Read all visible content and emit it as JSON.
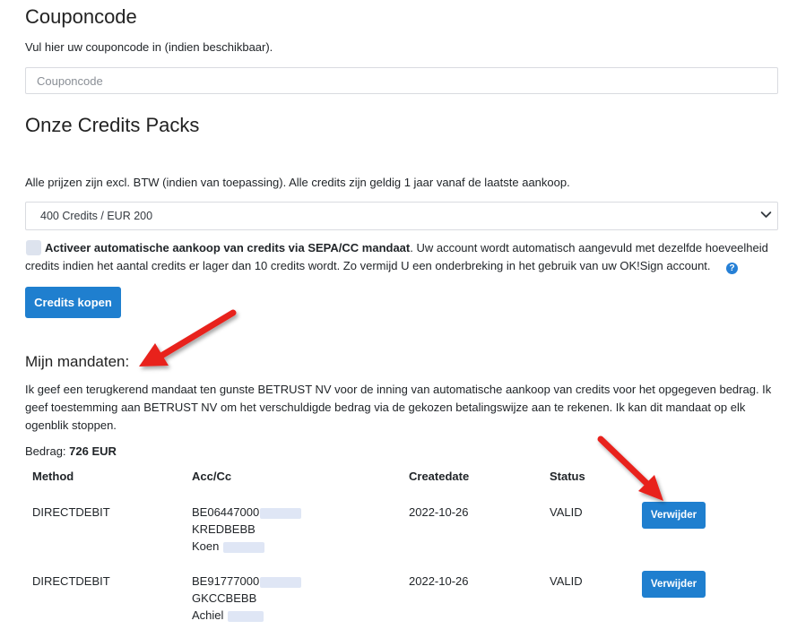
{
  "coupon": {
    "title": "Couponcode",
    "description": "Vul hier uw couponcode in (indien beschikbaar).",
    "placeholder": "Couponcode"
  },
  "packs": {
    "title": "Onze Credits Packs",
    "description": "Alle prijzen zijn excl. BTW (indien van toepassing). Alle credits zijn geldig 1 jaar vanaf de laatste aankoop.",
    "selected_option": "400 Credits /  EUR 200",
    "auto_purchase_bold": "Activeer automatische aankoop van credits via SEPA/CC mandaat",
    "auto_purchase_rest": ". Uw account wordt automatisch aangevuld met dezelfde hoeveelheid credits indien het aantal credits er lager dan 10 credits wordt. Zo vermijd U een onderbreking in het gebruik van uw OK!Sign account.",
    "help_icon": "question-circle-icon",
    "buy_button": "Credits kopen"
  },
  "mandates": {
    "title": "Mijn mandaten:",
    "description": "Ik geef een terugkerend mandaat ten gunste BETRUST NV voor de inning van automatische aankoop van credits voor het opgegeven bedrag. Ik geef toestemming aan BETRUST NV om het verschuldigde bedrag via de gekozen betalingswijze aan te rekenen. Ik kan dit mandaat op elk ogenblik stoppen.",
    "amount_label": "Bedrag: ",
    "amount_value": "726 EUR",
    "columns": [
      "Method",
      "Acc/Cc",
      "Createdate",
      "Status"
    ],
    "rows": [
      {
        "method": "DIRECTDEBIT",
        "acc_line1": "BE06447000",
        "acc_line2": "KREDBEBB",
        "acc_line3": "Koen",
        "createdate": "2022-10-26",
        "status": "VALID",
        "action": "Verwijder"
      },
      {
        "method": "DIRECTDEBIT",
        "acc_line1": "BE91777000",
        "acc_line2": "GKCCBEBB",
        "acc_line3": "Achiel",
        "createdate": "2022-10-26",
        "status": "VALID",
        "action": "Verwijder"
      }
    ]
  },
  "colors": {
    "primary_button": "#1f7fcf",
    "annotation_arrow": "#e8211f"
  }
}
